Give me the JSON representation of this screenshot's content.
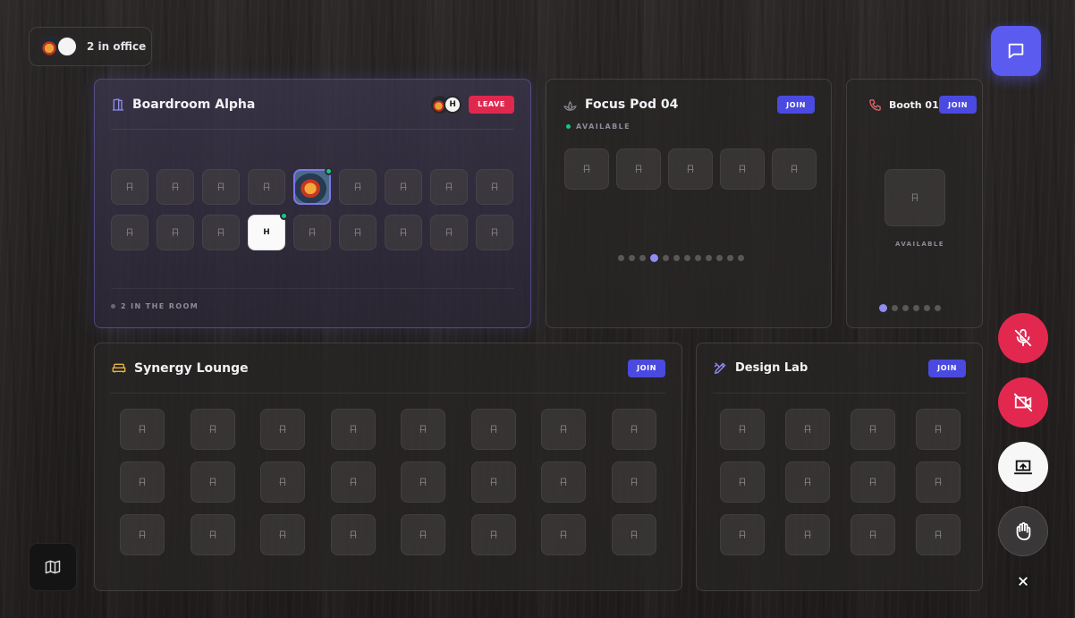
{
  "presence": {
    "count_label": "2 in office",
    "avatar_initial": "H"
  },
  "colors": {
    "accent": "#5b5bf0",
    "join": "#4a4ae0",
    "leave": "#e0284f",
    "online": "#17c77f"
  },
  "rooms": {
    "boardroom": {
      "name": "Boardroom Alpha",
      "action": "LEAVE",
      "avatar_initial": "H",
      "occupant_initial": "H",
      "status": "2 IN THE ROOM"
    },
    "focus": {
      "name": "Focus Pod 04",
      "action": "JOIN",
      "status": "AVAILABLE",
      "pages": 12,
      "current_page": 4
    },
    "booth": {
      "name": "Booth 01",
      "action": "JOIN",
      "status": "AVAILABLE",
      "pages": 6,
      "current_page": 1
    },
    "lounge": {
      "name": "Synergy Lounge",
      "action": "JOIN"
    },
    "lab": {
      "name": "Design Lab",
      "action": "JOIN"
    }
  },
  "controls": {
    "mic": "mic-off-icon",
    "camera": "video-off-icon",
    "screen": "screen-share-icon",
    "hand": "raise-hand-icon",
    "close": "close-icon"
  }
}
